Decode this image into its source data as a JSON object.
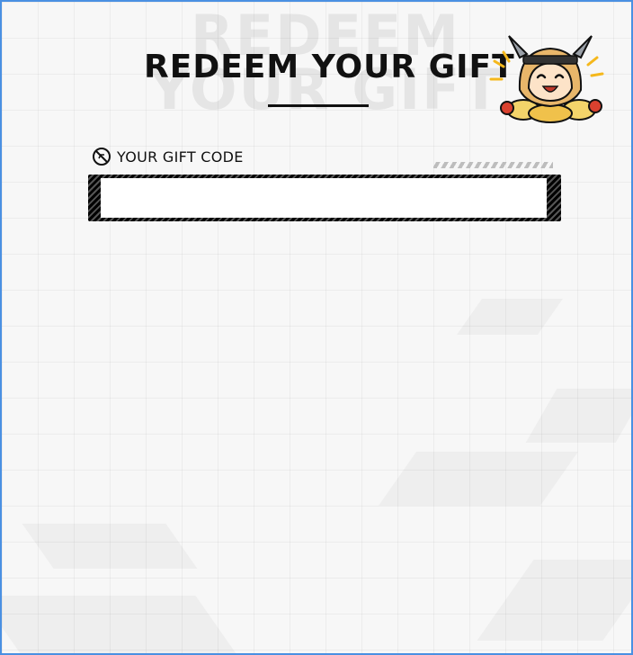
{
  "header": {
    "watermark_line1": "REDEEM",
    "watermark_line2": "YOUR GIFT",
    "title": "REDEEM YOUR GIFT"
  },
  "form": {
    "label": "YOUR GIFT CODE",
    "label_icon": "no-symbol-icon",
    "input_value": "",
    "input_placeholder": ""
  },
  "colors": {
    "frame_border": "#4a90e2",
    "background": "#f7f7f7",
    "text": "#111111",
    "mascot_accent": "#f5b81c"
  }
}
